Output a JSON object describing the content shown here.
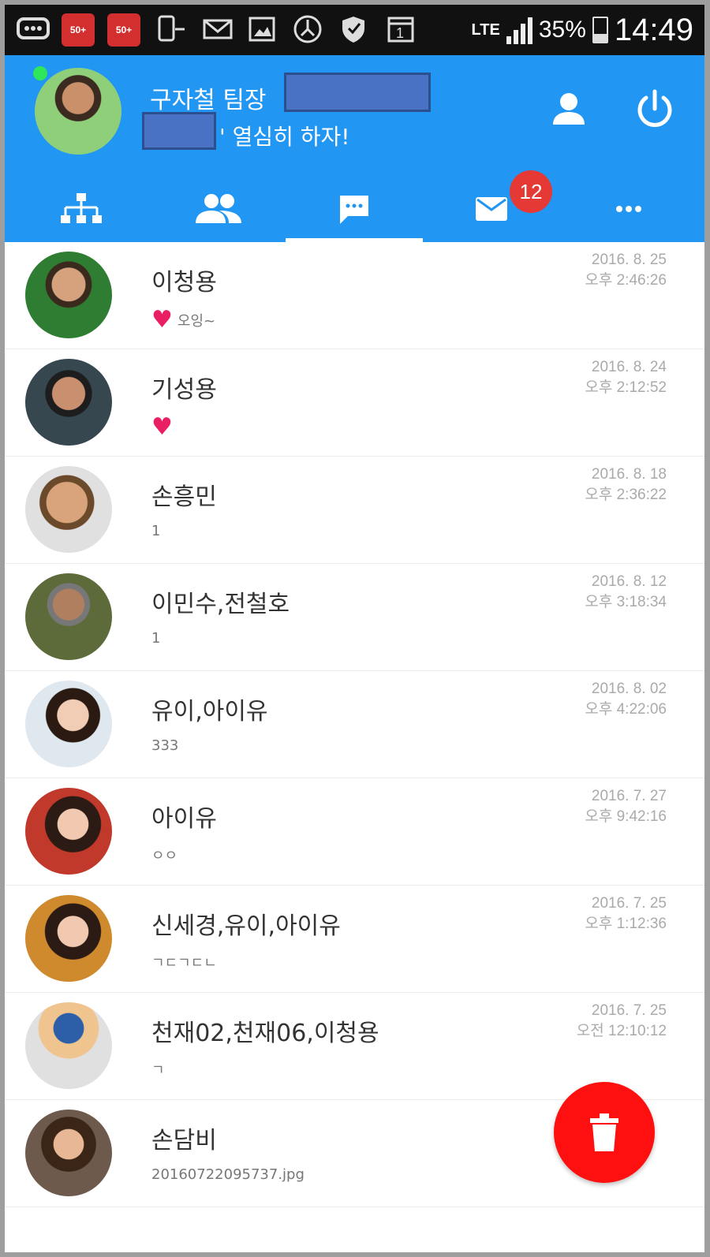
{
  "status_bar": {
    "app_icons": [
      "message-icon",
      "red-app-icon",
      "red-app-icon",
      "phone-device-icon",
      "mail-icon",
      "gallery-icon",
      "clock-icon",
      "shield-icon",
      "calendar-icon"
    ],
    "red_app_label": "50+",
    "calendar_day": "1",
    "network": "LTE",
    "battery": "35%",
    "battery_level": 0.35,
    "time": "14:49"
  },
  "header": {
    "name": "구자철 팀장",
    "status_message": "' 열심히 하자!",
    "colors": {
      "header": "#2196f3",
      "badge": "#e53935",
      "online": "#2ee65a",
      "fab": "#ff1010"
    }
  },
  "tabs": [
    {
      "icon": "org-chart-icon"
    },
    {
      "icon": "contacts-icon"
    },
    {
      "icon": "chat-icon",
      "active": true
    },
    {
      "icon": "mail-icon",
      "badge": "12"
    },
    {
      "icon": "more-icon"
    }
  ],
  "chats": [
    {
      "name": "이청용",
      "preview": "오잉~",
      "heart": true,
      "date": "2016. 8. 25",
      "time": "오후 2:46:26"
    },
    {
      "name": "기성용",
      "preview": "",
      "heart": true,
      "date": "2016. 8. 24",
      "time": "오후 2:12:52"
    },
    {
      "name": "손흥민",
      "preview": "1",
      "heart": false,
      "date": "2016. 8. 18",
      "time": "오후 2:36:22"
    },
    {
      "name": "이민수,전철호",
      "preview": "1",
      "heart": false,
      "date": "2016. 8. 12",
      "time": "오후 3:18:34"
    },
    {
      "name": "유이,아이유",
      "preview": "333",
      "heart": false,
      "date": "2016. 8. 02",
      "time": "오후 4:22:06"
    },
    {
      "name": "아이유",
      "preview": "ㅇㅇ",
      "heart": false,
      "date": "2016. 7. 27",
      "time": "오후 9:42:16"
    },
    {
      "name": "신세경,유이,아이유",
      "preview": "ㄱㄷㄱㄷㄴ",
      "heart": false,
      "date": "2016. 7. 25",
      "time": "오후 1:12:36"
    },
    {
      "name": "천재02,천재06,이청용",
      "preview": "ㄱ",
      "heart": false,
      "date": "2016. 7. 25",
      "time": "오전 12:10:12"
    },
    {
      "name": "손담비",
      "preview": "20160722095737.jpg",
      "heart": false,
      "date": "",
      "time": ""
    }
  ],
  "fab": {
    "icon": "trash-icon"
  }
}
